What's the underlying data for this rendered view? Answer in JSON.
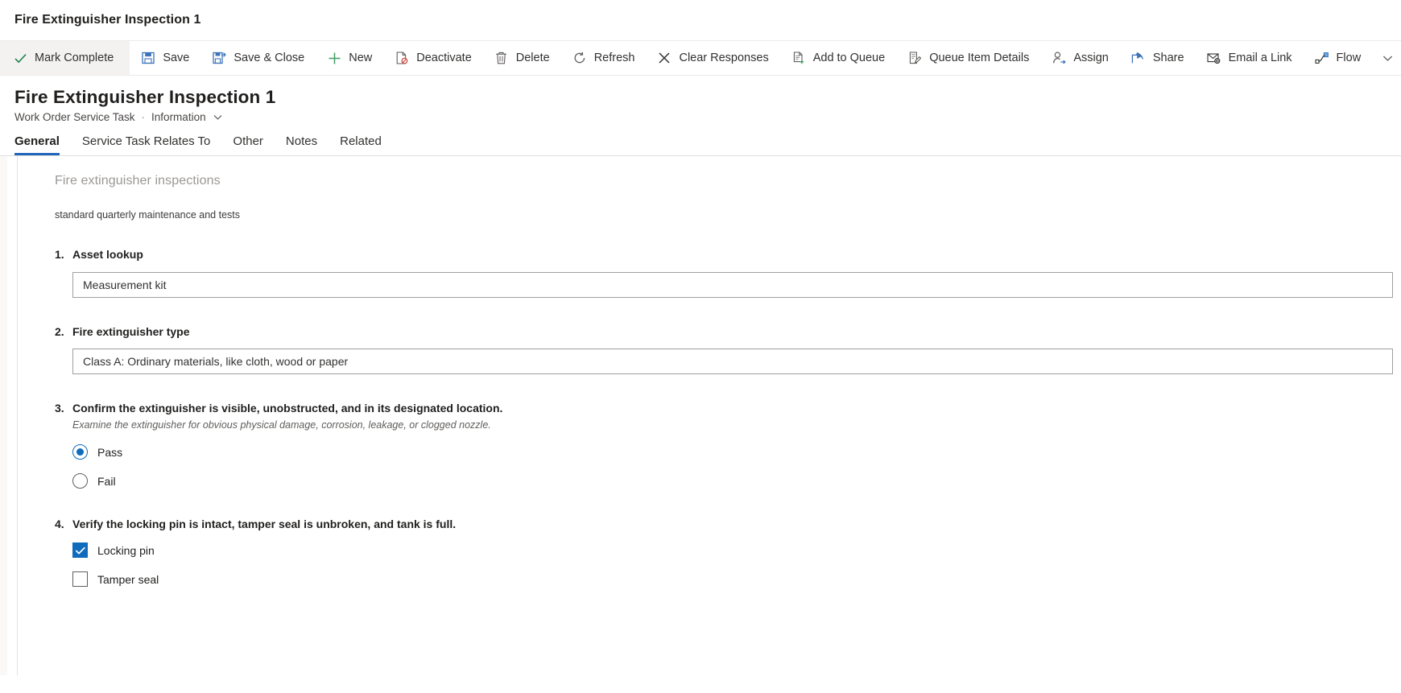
{
  "window": {
    "title": "Fire Extinguisher Inspection 1"
  },
  "commandbar": {
    "items": [
      {
        "label": "Mark Complete",
        "icon": "checkmark-icon"
      },
      {
        "label": "Save",
        "icon": "save-icon"
      },
      {
        "label": "Save & Close",
        "icon": "save-and-close-icon"
      },
      {
        "label": "New",
        "icon": "plus-icon"
      },
      {
        "label": "Deactivate",
        "icon": "deactivate-icon"
      },
      {
        "label": "Delete",
        "icon": "trash-icon"
      },
      {
        "label": "Refresh",
        "icon": "refresh-icon"
      },
      {
        "label": "Clear Responses",
        "icon": "close-x-icon"
      },
      {
        "label": "Add to Queue",
        "icon": "add-to-queue-icon"
      },
      {
        "label": "Queue Item Details",
        "icon": "queue-item-details-icon"
      },
      {
        "label": "Assign",
        "icon": "assign-person-icon"
      },
      {
        "label": "Share",
        "icon": "share-icon"
      },
      {
        "label": "Email a Link",
        "icon": "email-link-icon"
      },
      {
        "label": "Flow",
        "icon": "flow-icon"
      }
    ],
    "overflow_icon": "chevron-down-icon"
  },
  "record": {
    "title": "Fire Extinguisher Inspection 1",
    "entity": "Work Order Service Task",
    "separator": "·",
    "form_name": "Information",
    "form_chevron": "chevron-down-icon"
  },
  "tabs": [
    {
      "label": "General",
      "active": true
    },
    {
      "label": "Service Task Relates To",
      "active": false
    },
    {
      "label": "Other",
      "active": false
    },
    {
      "label": "Notes",
      "active": false
    },
    {
      "label": "Related",
      "active": false
    }
  ],
  "inspection": {
    "heading": "Fire extinguisher inspections",
    "description": "standard quarterly maintenance and tests",
    "questions": [
      {
        "number": "1.",
        "text": "Asset lookup",
        "type": "lookup",
        "value": "Measurement kit"
      },
      {
        "number": "2.",
        "text": "Fire extinguisher type",
        "type": "dropdown",
        "value": "Class A: Ordinary materials, like cloth, wood or paper"
      },
      {
        "number": "3.",
        "text": "Confirm the extinguisher is visible, unobstructed, and in its designated location.",
        "hint": "Examine the extinguisher for obvious physical damage, corrosion, leakage, or clogged nozzle.",
        "type": "radio",
        "options": [
          {
            "label": "Pass",
            "checked": true
          },
          {
            "label": "Fail",
            "checked": false
          }
        ]
      },
      {
        "number": "4.",
        "text": "Verify the locking pin is intact, tamper seal is unbroken, and tank is full.",
        "type": "checkbox",
        "options": [
          {
            "label": "Locking pin",
            "checked": true
          },
          {
            "label": "Tamper seal",
            "checked": false
          }
        ]
      }
    ]
  },
  "colors": {
    "accent": "#0f6cbd",
    "tab_underline": "#2266bb",
    "command_icon_blue": "#3b73b9",
    "command_icon_green": "#107c41",
    "text_primary": "#201f1e",
    "text_secondary": "#605e5c",
    "placeholder_gray": "#9a9896"
  }
}
